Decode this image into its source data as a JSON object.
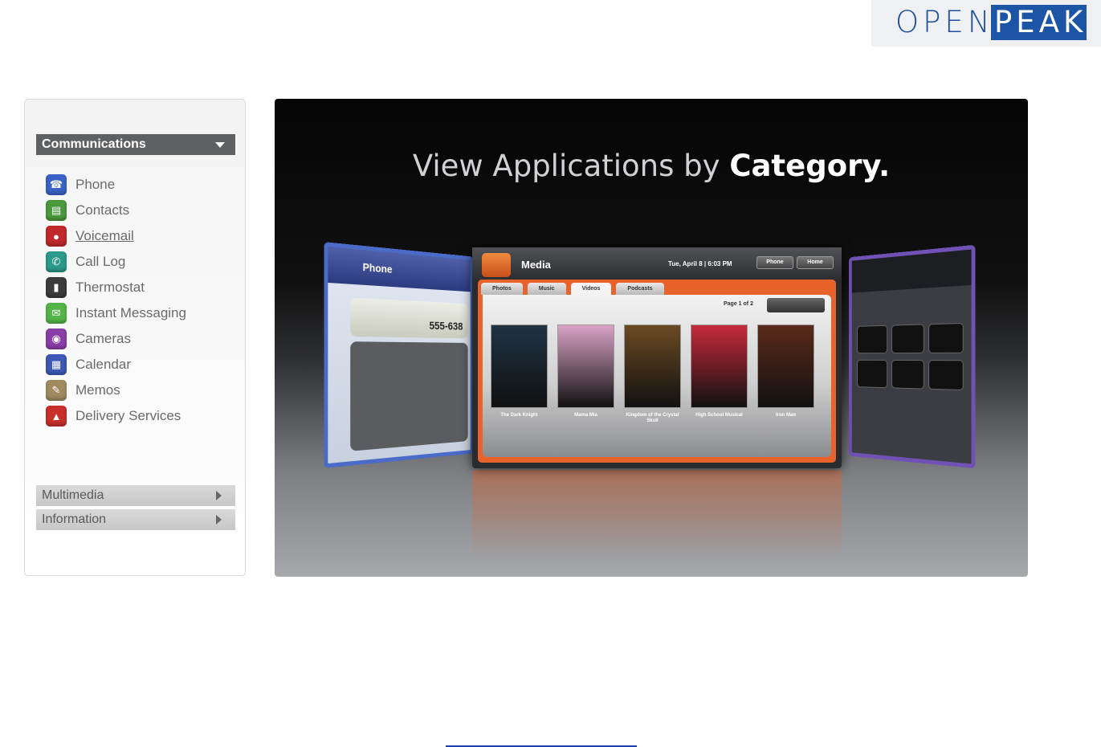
{
  "logo": {
    "open": "OPEN",
    "peak": "PEAK"
  },
  "sidebar": {
    "active_category": "Communications",
    "items": [
      {
        "label": "Phone",
        "icon": "phone-icon",
        "color": "#3a62c8",
        "glyph": "☎",
        "link": false
      },
      {
        "label": "Contacts",
        "icon": "contacts-icon",
        "color": "#4a9a3c",
        "glyph": "▤",
        "link": false
      },
      {
        "label": "Voicemail",
        "icon": "voicemail-icon",
        "color": "#c0282b",
        "glyph": "●",
        "link": true
      },
      {
        "label": "Call Log",
        "icon": "call-log-icon",
        "color": "#2b9a8a",
        "glyph": "✆",
        "link": false
      },
      {
        "label": "Thermostat",
        "icon": "thermostat-icon",
        "color": "#3c3c3c",
        "glyph": "▮",
        "link": false
      },
      {
        "label": "Instant Messaging",
        "icon": "instant-messaging-icon",
        "color": "#54b548",
        "glyph": "✉",
        "link": false
      },
      {
        "label": "Cameras",
        "icon": "cameras-icon",
        "color": "#8a3ea8",
        "glyph": "◉",
        "link": false
      },
      {
        "label": "Calendar",
        "icon": "calendar-icon",
        "color": "#3e58b8",
        "glyph": "▦",
        "link": false
      },
      {
        "label": "Memos",
        "icon": "memos-icon",
        "color": "#a08a60",
        "glyph": "✎",
        "link": false
      },
      {
        "label": "Delivery Services",
        "icon": "delivery-services-icon",
        "color": "#c8302c",
        "glyph": "▲",
        "link": false
      }
    ],
    "collapsed_categories": [
      "Multimedia",
      "Information"
    ]
  },
  "hero": {
    "title_prefix": "View Applications by ",
    "title_bold": "Category.",
    "phone_panel": {
      "title": "Phone",
      "number": "555-638"
    },
    "media": {
      "title": "Media",
      "date": "Tue, April 8  |  6:03 PM",
      "buttons": [
        "Phone",
        "Home"
      ],
      "tabs": [
        "Photos",
        "Music",
        "Videos",
        "Podcasts"
      ],
      "active_tab": "Videos",
      "pager": "Page 1 of 2",
      "posters": [
        {
          "caption": "The Dark Knight",
          "color": "#1f3344"
        },
        {
          "caption": "Mama Mia",
          "color": "#d9a3c6"
        },
        {
          "caption": "Kingdom of the Crystal Skull",
          "color": "#6b4a22"
        },
        {
          "caption": "High School Musical",
          "color": "#c52a3a"
        },
        {
          "caption": "Iron Man",
          "color": "#5a2a1a"
        }
      ]
    }
  }
}
